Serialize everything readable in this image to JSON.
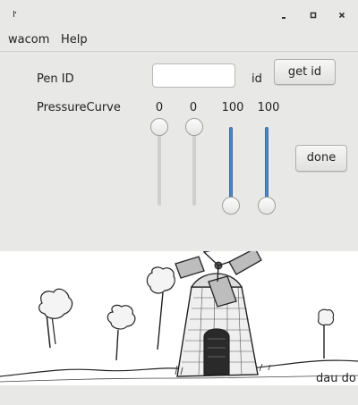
{
  "window": {
    "controls": [
      "minimize-icon",
      "maximize-icon",
      "close-icon"
    ]
  },
  "menu": {
    "items": [
      "wacom",
      "Help"
    ]
  },
  "form": {
    "pen_id_label": "Pen ID",
    "pen_id_value": "",
    "id_label": "id",
    "get_id_label": "get id",
    "pressure_label": "PressureCurve",
    "done_label": "done"
  },
  "pressure_curve": {
    "values": [
      "0",
      "0",
      "100",
      "100"
    ],
    "levels": [
      0,
      0,
      100,
      100
    ]
  },
  "image": {
    "caption": "dau do"
  },
  "colors": {
    "accent": "#4a86c8",
    "background": "#e8e8e7"
  }
}
